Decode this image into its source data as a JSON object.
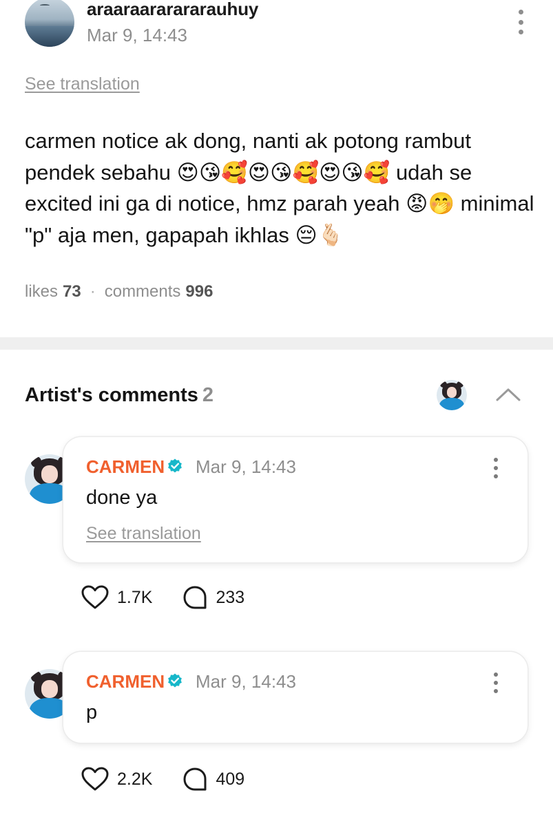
{
  "post": {
    "author": "araaraararararauhuy",
    "time": "Mar 9, 14:43",
    "see_translation": "See translation",
    "body": "carmen notice ak dong, nanti ak potong rambut pendek sebahu 😍😘🥰😍😘🥰😍😘🥰 udah se excited ini ga di notice, hmz parah yeah 😡🤭 minimal \"p\" aja men, gapapah ikhlas 😔🫰🏻",
    "likes_label": "likes",
    "likes": "73",
    "comments_label": "comments",
    "comments": "996"
  },
  "artist_comments": {
    "title": "Artist's comments",
    "count": "2",
    "items": [
      {
        "name": "CARMEN",
        "time": "Mar 9, 14:43",
        "text": "done ya",
        "see_translation": "See translation",
        "likes": "1.7K",
        "replies": "233"
      },
      {
        "name": "CARMEN",
        "time": "Mar 9, 14:43",
        "text": "p",
        "likes": "2.2K",
        "replies": "409"
      }
    ]
  },
  "colors": {
    "artist_name": "#f0602e",
    "verified": "#17b7c9",
    "muted": "#8e8e8e"
  },
  "icons": [
    "more-vertical-icon",
    "chevron-up-icon",
    "verified-badge-icon",
    "heart-icon",
    "comment-bubble-icon"
  ]
}
